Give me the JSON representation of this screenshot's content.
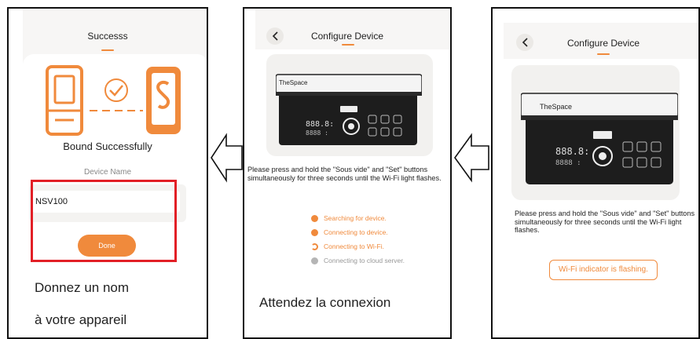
{
  "panel1": {
    "title": "Successs",
    "status": "Bound Successfully",
    "field_label": "Device Name",
    "device_name_value": "NSV100",
    "done_label": "Done",
    "caption_line1": "Donnez un nom",
    "caption_line2": "à votre appareil"
  },
  "panel2": {
    "title": "Configure Device",
    "device_brand": "TheSpace",
    "instruction": "Please press and hold the \"Sous vide\" and \"Set\" buttons simultaneously for three seconds until the Wi-Fi light flashes.",
    "steps": [
      {
        "label": "Searching for device.",
        "state": "done"
      },
      {
        "label": "Connecting to device.",
        "state": "done"
      },
      {
        "label": "Connecting to Wi-Fi.",
        "state": "loading"
      },
      {
        "label": "Connecting to cloud server.",
        "state": "pending"
      }
    ],
    "caption": "Attendez la connexion"
  },
  "panel3": {
    "title": "Configure Device",
    "device_brand": "TheSpace",
    "instruction": "Please press and hold the \"Sous vide\" and \"Set\" buttons simultaneously for three seconds until the Wi-Fi light flashes.",
    "button_label": "Wi-Fi indicator is flashing."
  },
  "colors": {
    "accent": "#f08a3c",
    "highlight": "#e21f26",
    "pending": "#b5b5b5"
  }
}
